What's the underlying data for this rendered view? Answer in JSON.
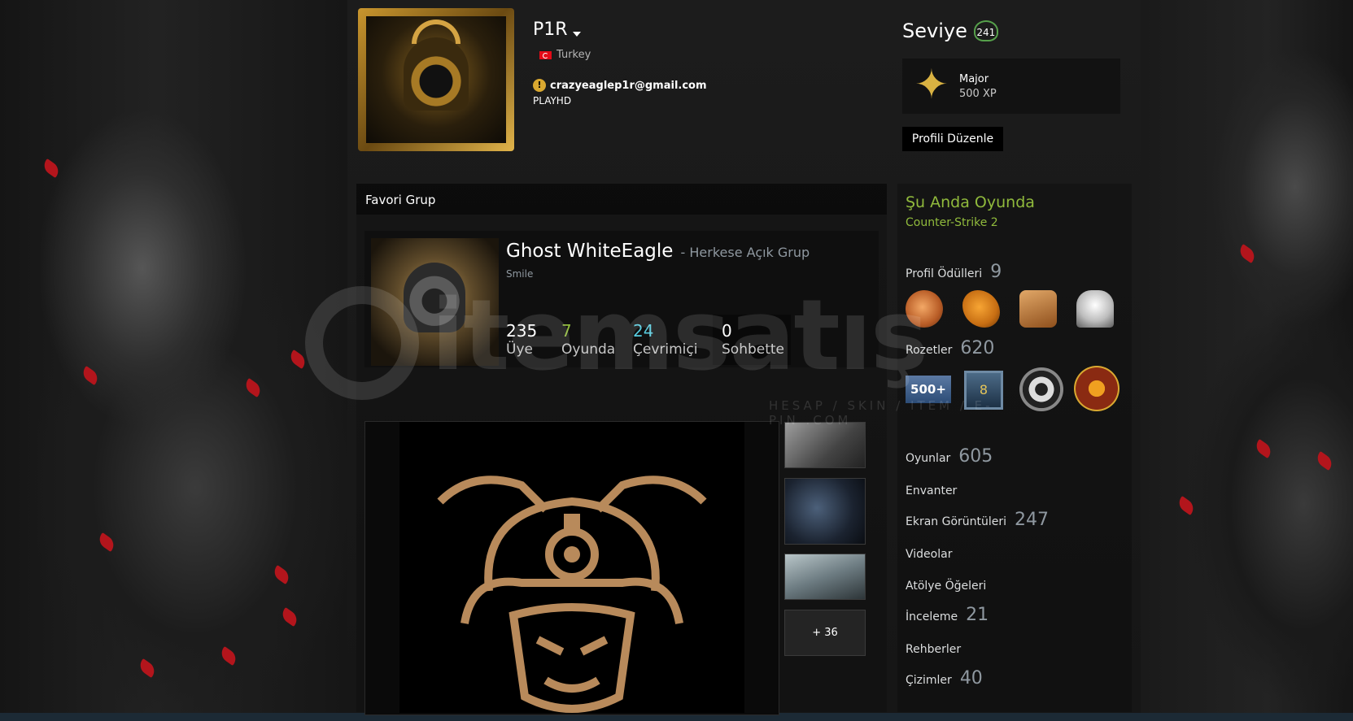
{
  "profile": {
    "name": "P1R",
    "country": "Turkey",
    "email": "crazyeaglep1r@gmail.com",
    "tagline": "PLAYHD"
  },
  "level": {
    "label": "Seviye",
    "value": "241",
    "rank": "Major",
    "xp": "500 XP",
    "edit_button": "Profili Düzenle"
  },
  "favorite_group": {
    "header": "Favori Grup",
    "name": "Ghost WhiteEagle",
    "type": "- Herkese Açık Grup",
    "description": "Smile",
    "stats": [
      {
        "value": "235",
        "label": "Üye",
        "color": "#ffffff"
      },
      {
        "value": "7",
        "label": "Oyunda",
        "color": "#90ba3c"
      },
      {
        "value": "24",
        "label": "Çevrimiçi",
        "color": "#57cbde"
      },
      {
        "value": "0",
        "label": "Sohbette",
        "color": "#ffffff"
      }
    ]
  },
  "showcase": {
    "more_label": "+ 36"
  },
  "sidebar": {
    "in_game_title": "Şu Anda Oyunda",
    "in_game_name": "Counter-Strike 2",
    "awards_label": "Profil Ödülleri",
    "awards_count": "9",
    "badges_label": "Rozetler",
    "badges_count": "620",
    "badge_500_label": "500+",
    "badge_level_label": "8",
    "links": [
      {
        "label": "Oyunlar",
        "count": "605"
      },
      {
        "label": "Envanter",
        "count": ""
      },
      {
        "label": "Ekran Görüntüleri",
        "count": "247"
      },
      {
        "label": "Videolar",
        "count": ""
      },
      {
        "label": "Atölye Öğeleri",
        "count": ""
      },
      {
        "label": "İnceleme",
        "count": "21"
      },
      {
        "label": "Rehberler",
        "count": ""
      },
      {
        "label": "Çizimler",
        "count": "40"
      }
    ]
  },
  "watermark": {
    "text": "itemsatış",
    "sub": "HESAP / SKIN / ITEM / E-PIN .COM"
  },
  "colors": {
    "accent_green": "#90ba3c",
    "online_blue": "#57cbde",
    "level_border": "#56a04b"
  }
}
